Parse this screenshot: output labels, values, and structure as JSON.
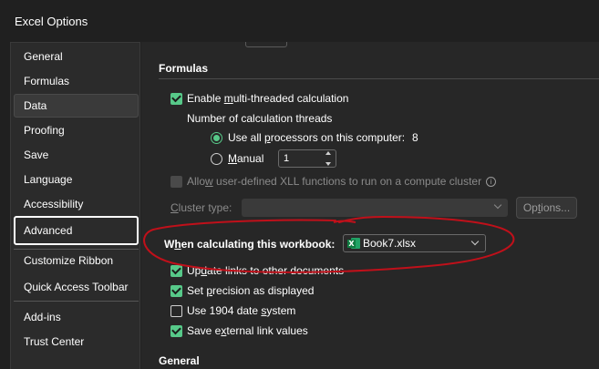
{
  "window": {
    "title": "Excel Options"
  },
  "sidebar": {
    "items": [
      {
        "label": "General"
      },
      {
        "label": "Formulas"
      },
      {
        "label": "Data"
      },
      {
        "label": "Proofing"
      },
      {
        "label": "Save"
      },
      {
        "label": "Language"
      },
      {
        "label": "Accessibility"
      },
      {
        "label": "Advanced"
      },
      {
        "label": "Customize Ribbon"
      },
      {
        "label": "Quick Access Toolbar"
      },
      {
        "label": "Add-ins"
      },
      {
        "label": "Trust Center"
      }
    ]
  },
  "formulas": {
    "heading": "Formulas",
    "multithread": {
      "pre": "Enable ",
      "ul": "m",
      "post": "ulti-threaded calculation",
      "checked": true
    },
    "threads_label": "Number of calculation threads",
    "all_processors": {
      "pre": "Use all ",
      "ul": "p",
      "post": "rocessors on this computer:",
      "value": "8",
      "selected": true
    },
    "manual": {
      "ul": "M",
      "post": "anual",
      "value": "1",
      "selected": false
    },
    "xll": {
      "pre": "Allo",
      "ul": "w",
      "post": " user-defined XLL functions to run on a compute cluster",
      "checked": false,
      "enabled": false
    },
    "cluster_type": {
      "ul": "C",
      "post": "luster type:"
    },
    "options_button": {
      "pre": "Op",
      "ul": "t",
      "post": "ions..."
    }
  },
  "workbook": {
    "label_pre": "W",
    "label_ul": "h",
    "label_post": "en calculating this workbook:",
    "selected": "Book7.xlsx",
    "file_icon": "excel-file-icon",
    "options": [
      {
        "pre": "Up",
        "ul": "d",
        "post": "ate links to other documents",
        "checked": true
      },
      {
        "pre": "Set ",
        "ul": "p",
        "post": "recision as displayed",
        "checked": true
      },
      {
        "pre": "Use 1904 date ",
        "ul": "s",
        "post": "ystem",
        "checked": false
      },
      {
        "pre": "Save e",
        "ul": "x",
        "post": "ternal link values",
        "checked": true
      }
    ]
  },
  "general": {
    "heading": "General"
  },
  "colors": {
    "accent": "#57c989",
    "annotation": "#c0101a",
    "background": "#272727"
  }
}
